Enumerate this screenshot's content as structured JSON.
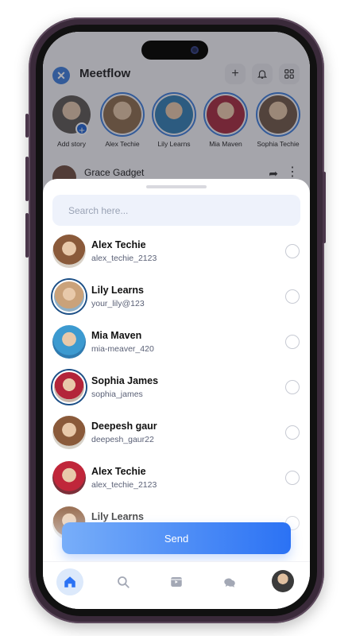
{
  "app": {
    "name": "Meetflow"
  },
  "stories": [
    {
      "label": "Add story"
    },
    {
      "label": "Alex Techie"
    },
    {
      "label": "Lily Learns"
    },
    {
      "label": "Mia Maven"
    },
    {
      "label": "Sophia Techie"
    }
  ],
  "post": {
    "author": "Grace Gadget"
  },
  "sheet": {
    "search_placeholder": "Search here...",
    "contacts": [
      {
        "name": "Alex Techie",
        "handle": "alex_techie_2123",
        "ring": false,
        "colors": [
          "#d9d2c8",
          "#8a5a3a"
        ]
      },
      {
        "name": "Lily Learns",
        "handle": "your_lily@123",
        "ring": true,
        "colors": [
          "#8fb0c7",
          "#caa27a"
        ]
      },
      {
        "name": "Mia Maven",
        "handle": "mia-meaver_420",
        "ring": false,
        "colors": [
          "#2f7bb0",
          "#3c9ad0"
        ]
      },
      {
        "name": "Sophia James",
        "handle": "sophia_james",
        "ring": true,
        "colors": [
          "#c7b5a8",
          "#b3243a"
        ]
      },
      {
        "name": "Deepesh gaur",
        "handle": "deepesh_gaur22",
        "ring": false,
        "colors": [
          "#d7d2c9",
          "#8a5a3a"
        ]
      },
      {
        "name": "Alex Techie",
        "handle": "alex_techie_2123",
        "ring": false,
        "colors": [
          "#7b2f39",
          "#c0263a"
        ]
      },
      {
        "name": "Lily Learns",
        "handle": "",
        "ring": false,
        "colors": [
          "#d7d2c9",
          "#8a5a3a"
        ]
      }
    ],
    "send_label": "Send"
  },
  "nav": {
    "items": [
      "home-icon",
      "search-icon",
      "reels-icon",
      "chat-icon",
      "profile-avatar"
    ]
  },
  "colors": {
    "accent": "#2b72f4",
    "nav_active": "#dce9fb"
  }
}
